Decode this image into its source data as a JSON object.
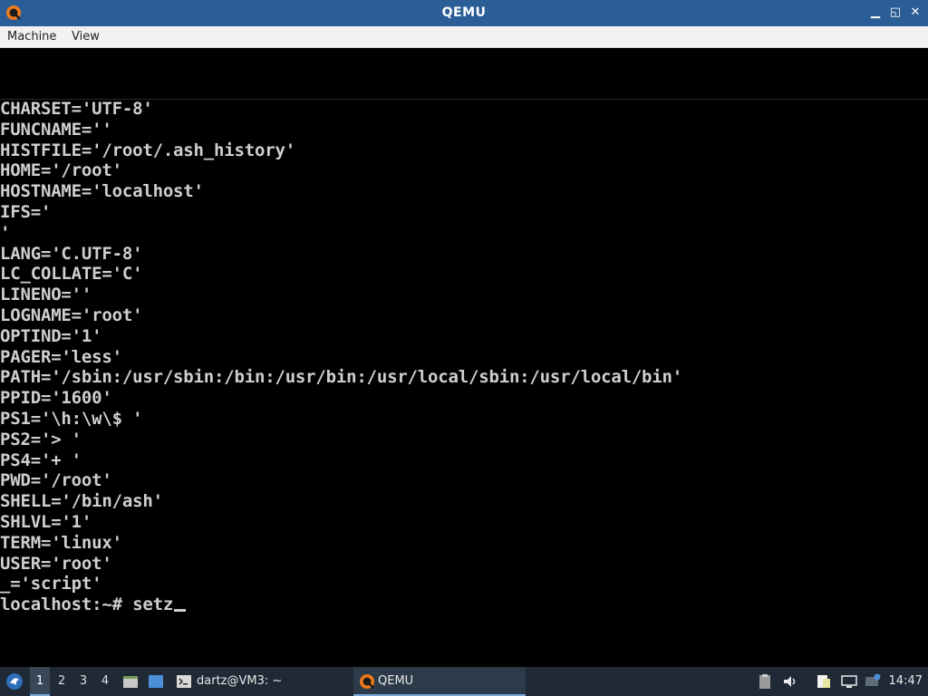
{
  "window": {
    "title": "QEMU",
    "controls": {
      "minimize": "▁",
      "restore": "◱",
      "close": "✕"
    }
  },
  "menubar": {
    "items": [
      {
        "label": "Machine"
      },
      {
        "label": "View"
      }
    ]
  },
  "console": {
    "lines": [
      "CHARSET='UTF-8'",
      "FUNCNAME=''",
      "HISTFILE='/root/.ash_history'",
      "HOME='/root'",
      "HOSTNAME='localhost'",
      "IFS='",
      "'",
      "LANG='C.UTF-8'",
      "LC_COLLATE='C'",
      "LINENO=''",
      "LOGNAME='root'",
      "OPTIND='1'",
      "PAGER='less'",
      "PATH='/sbin:/usr/sbin:/bin:/usr/bin:/usr/local/sbin:/usr/local/bin'",
      "PPID='1600'",
      "PS1='\\h:\\w\\$ '",
      "PS2='> '",
      "PS4='+ '",
      "PWD='/root'",
      "SHELL='/bin/ash'",
      "SHLVL='1'",
      "TERM='linux'",
      "USER='root'",
      "_='script'"
    ],
    "prompt": "localhost:~# setz"
  },
  "taskbar": {
    "workspaces": [
      "1",
      "2",
      "3",
      "4"
    ],
    "active_workspace": "1",
    "tasks": [
      {
        "label": "dartz@VM3: ~",
        "icon": "terminal-icon"
      },
      {
        "label": "QEMU",
        "icon": "qemu-icon"
      }
    ],
    "clock": "14:47"
  },
  "colors": {
    "titlebar": "#2b5d96",
    "menubar": "#f2f2f2",
    "console_bg": "#000000",
    "console_fg": "#cfcfcf",
    "taskbar": "#1f2a36"
  }
}
